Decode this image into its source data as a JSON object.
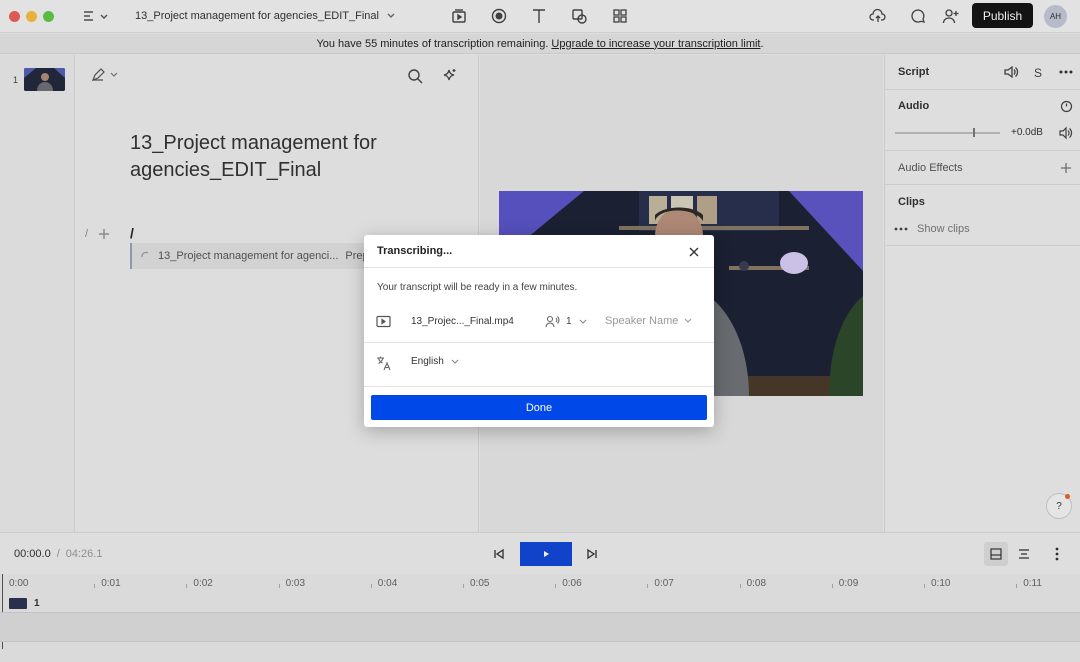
{
  "titlebar": {
    "project_title": "13_Project management for agencies_EDIT_Final",
    "publish_label": "Publish",
    "avatar_initials": "AH"
  },
  "banner": {
    "text": "You have 55 minutes of transcription remaining.",
    "link": "Upgrade to increase your transcription limit",
    "suffix": "."
  },
  "thumbnails": [
    {
      "number": "1"
    }
  ],
  "script": {
    "doc_title": "13_Project management for agencies_EDIT_Final",
    "slash_hint": "/",
    "cursor_text": "/",
    "clip_row_label": "13_Project management for agenci...",
    "clip_row_status": "Prepa"
  },
  "right_panel": {
    "tab_label": "Script",
    "s_label": "S",
    "audio_title": "Audio",
    "gain_value": "+0.0dB",
    "audio_effects_label": "Audio Effects",
    "clips_title": "Clips",
    "show_clips_label": "Show clips"
  },
  "transport": {
    "current_time": "00:00.0",
    "separator": "/",
    "total_time": "04:26.1"
  },
  "timeline": {
    "ticks": [
      "0:00",
      "0:01",
      "0:02",
      "0:03",
      "0:04",
      "0:05",
      "0:06",
      "0:07",
      "0:08",
      "0:09",
      "0:10",
      "0:11"
    ],
    "track_number": "1"
  },
  "dialog": {
    "title": "Transcribing...",
    "message": "Your transcript will be ready in a few minutes.",
    "file_name": "13_Projec..._Final.mp4",
    "speaker_count": "1",
    "speaker_placeholder": "Speaker Name",
    "language": "English",
    "done_label": "Done"
  },
  "help_label": "?",
  "colors": {
    "accent": "#0048e8",
    "play_button": "#1248d6",
    "publish_bg": "#151515"
  }
}
